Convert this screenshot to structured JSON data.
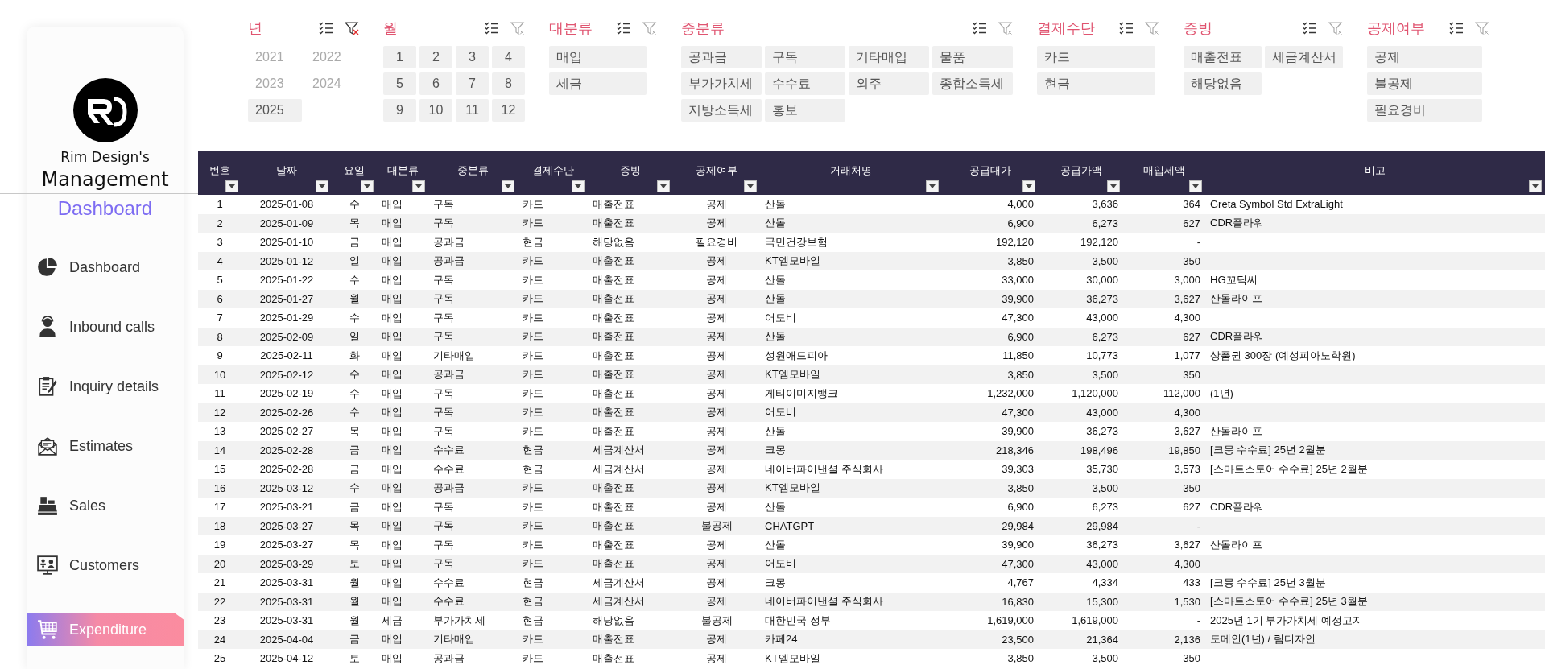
{
  "sidebar": {
    "brand_line1": "Rim Design's",
    "brand_line2": "Management",
    "brand_line3": "Dashboard",
    "items": [
      {
        "label": "Dashboard",
        "kind": "pie",
        "selected": false
      },
      {
        "label": "Inbound calls",
        "kind": "agent",
        "selected": false
      },
      {
        "label": "Inquiry details",
        "kind": "clipboard",
        "selected": false
      },
      {
        "label": "Estimates",
        "kind": "mail",
        "selected": false
      },
      {
        "label": "Sales",
        "kind": "register",
        "selected": false
      },
      {
        "label": "Customers",
        "kind": "contacts",
        "selected": false
      },
      {
        "label": "Expenditure",
        "kind": "cart",
        "selected": true
      }
    ]
  },
  "slicers": [
    {
      "title": "년",
      "filter_active": true,
      "items": [
        {
          "label": "2021",
          "selected": false
        },
        {
          "label": "2022",
          "selected": false
        },
        {
          "label": "2023",
          "selected": false
        },
        {
          "label": "2024",
          "selected": false
        },
        {
          "label": "2025",
          "selected": true
        }
      ]
    },
    {
      "title": "월",
      "filter_active": false,
      "items": [
        {
          "label": "1",
          "selected": true
        },
        {
          "label": "2",
          "selected": true
        },
        {
          "label": "3",
          "selected": true
        },
        {
          "label": "4",
          "selected": true
        },
        {
          "label": "5",
          "selected": true
        },
        {
          "label": "6",
          "selected": true
        },
        {
          "label": "7",
          "selected": true
        },
        {
          "label": "8",
          "selected": true
        },
        {
          "label": "9",
          "selected": true
        },
        {
          "label": "10",
          "selected": true
        },
        {
          "label": "11",
          "selected": true
        },
        {
          "label": "12",
          "selected": true
        }
      ]
    },
    {
      "title": "대분류",
      "filter_active": false,
      "items": [
        {
          "label": "매입",
          "selected": true
        },
        {
          "label": "세금",
          "selected": true
        }
      ]
    },
    {
      "title": "중분류",
      "filter_active": false,
      "items": [
        {
          "label": "공과금",
          "selected": true
        },
        {
          "label": "구독",
          "selected": true
        },
        {
          "label": "기타매입",
          "selected": true
        },
        {
          "label": "물품",
          "selected": true
        },
        {
          "label": "부가가치세",
          "selected": true
        },
        {
          "label": "수수료",
          "selected": true
        },
        {
          "label": "외주",
          "selected": true
        },
        {
          "label": "종합소득세",
          "selected": true
        },
        {
          "label": "지방소득세",
          "selected": true
        },
        {
          "label": "홍보",
          "selected": true
        }
      ]
    },
    {
      "title": "결제수단",
      "filter_active": false,
      "items": [
        {
          "label": "카드",
          "selected": true
        },
        {
          "label": "현금",
          "selected": true
        }
      ]
    },
    {
      "title": "증빙",
      "filter_active": false,
      "items": [
        {
          "label": "매출전표",
          "selected": true
        },
        {
          "label": "세금계산서",
          "selected": true
        },
        {
          "label": "해당없음",
          "selected": true
        }
      ]
    },
    {
      "title": "공제여부",
      "filter_active": false,
      "items": [
        {
          "label": "공제",
          "selected": true
        },
        {
          "label": "불공제",
          "selected": true
        },
        {
          "label": "필요경비",
          "selected": true
        }
      ]
    }
  ],
  "table": {
    "columns": [
      {
        "label": "번호"
      },
      {
        "label": "날짜"
      },
      {
        "label": "요일"
      },
      {
        "label": "대분류"
      },
      {
        "label": "중분류"
      },
      {
        "label": "결제수단"
      },
      {
        "label": "증빙"
      },
      {
        "label": "공제여부"
      },
      {
        "label": "거래처명"
      },
      {
        "label": "공급대가"
      },
      {
        "label": "공급가액"
      },
      {
        "label": "매입세액"
      },
      {
        "label": "비고"
      }
    ],
    "rows": [
      [
        "1",
        "2025-01-08",
        "수",
        "매입",
        "구독",
        "카드",
        "매출전표",
        "공제",
        "산돌",
        "4,000",
        "3,636",
        "364",
        "Greta Symbol Std ExtraLight"
      ],
      [
        "2",
        "2025-01-09",
        "목",
        "매입",
        "구독",
        "카드",
        "매출전표",
        "공제",
        "산돌",
        "6,900",
        "6,273",
        "627",
        "CDR플라워"
      ],
      [
        "3",
        "2025-01-10",
        "금",
        "매입",
        "공과금",
        "현금",
        "해당없음",
        "필요경비",
        "국민건강보험",
        "192,120",
        "192,120",
        "-"
      ],
      [
        "4",
        "2025-01-12",
        "일",
        "매입",
        "공과금",
        "카드",
        "매출전표",
        "공제",
        "KT엠모바일",
        "3,850",
        "3,500",
        "350"
      ],
      [
        "5",
        "2025-01-22",
        "수",
        "매입",
        "구독",
        "카드",
        "매출전표",
        "공제",
        "산돌",
        "33,000",
        "30,000",
        "3,000",
        "HG꼬딕씨"
      ],
      [
        "6",
        "2025-01-27",
        "월",
        "매입",
        "구독",
        "카드",
        "매출전표",
        "공제",
        "산돌",
        "39,900",
        "36,273",
        "3,627",
        "산돌라이프"
      ],
      [
        "7",
        "2025-01-29",
        "수",
        "매입",
        "구독",
        "카드",
        "매출전표",
        "공제",
        "어도비",
        "47,300",
        "43,000",
        "4,300"
      ],
      [
        "8",
        "2025-02-09",
        "일",
        "매입",
        "구독",
        "카드",
        "매출전표",
        "공제",
        "산돌",
        "6,900",
        "6,273",
        "627",
        "CDR플라워"
      ],
      [
        "9",
        "2025-02-11",
        "화",
        "매입",
        "기타매입",
        "카드",
        "매출전표",
        "공제",
        "성원애드피아",
        "11,850",
        "10,773",
        "1,077",
        "상품권 300장 (예성피아노학원)"
      ],
      [
        "10",
        "2025-02-12",
        "수",
        "매입",
        "공과금",
        "카드",
        "매출전표",
        "공제",
        "KT엠모바일",
        "3,850",
        "3,500",
        "350"
      ],
      [
        "11",
        "2025-02-19",
        "수",
        "매입",
        "구독",
        "카드",
        "매출전표",
        "공제",
        "게티이미지뱅크",
        "1,232,000",
        "1,120,000",
        "112,000",
        "(1년)"
      ],
      [
        "12",
        "2025-02-26",
        "수",
        "매입",
        "구독",
        "카드",
        "매출전표",
        "공제",
        "어도비",
        "47,300",
        "43,000",
        "4,300"
      ],
      [
        "13",
        "2025-02-27",
        "목",
        "매입",
        "구독",
        "카드",
        "매출전표",
        "공제",
        "산돌",
        "39,900",
        "36,273",
        "3,627",
        "산돌라이프"
      ],
      [
        "14",
        "2025-02-28",
        "금",
        "매입",
        "수수료",
        "현금",
        "세금계산서",
        "공제",
        "크몽",
        "218,346",
        "198,496",
        "19,850",
        "[크몽 수수료] 25년 2월분"
      ],
      [
        "15",
        "2025-02-28",
        "금",
        "매입",
        "수수료",
        "현금",
        "세금계산서",
        "공제",
        "네이버파이낸셜 주식회사",
        "39,303",
        "35,730",
        "3,573",
        "[스마트스토어 수수료] 25년 2월분"
      ],
      [
        "16",
        "2025-03-12",
        "수",
        "매입",
        "공과금",
        "카드",
        "매출전표",
        "공제",
        "KT엠모바일",
        "3,850",
        "3,500",
        "350"
      ],
      [
        "17",
        "2025-03-21",
        "금",
        "매입",
        "구독",
        "카드",
        "매출전표",
        "공제",
        "산돌",
        "6,900",
        "6,273",
        "627",
        "CDR플라워"
      ],
      [
        "18",
        "2025-03-27",
        "목",
        "매입",
        "구독",
        "카드",
        "매출전표",
        "불공제",
        "CHATGPT",
        "29,984",
        "29,984",
        "-"
      ],
      [
        "19",
        "2025-03-27",
        "목",
        "매입",
        "구독",
        "카드",
        "매출전표",
        "공제",
        "산돌",
        "39,900",
        "36,273",
        "3,627",
        "산돌라이프"
      ],
      [
        "20",
        "2025-03-29",
        "토",
        "매입",
        "구독",
        "카드",
        "매출전표",
        "공제",
        "어도비",
        "47,300",
        "43,000",
        "4,300"
      ],
      [
        "21",
        "2025-03-31",
        "월",
        "매입",
        "수수료",
        "현금",
        "세금계산서",
        "공제",
        "크몽",
        "4,767",
        "4,334",
        "433",
        "[크몽 수수료] 25년 3월분"
      ],
      [
        "22",
        "2025-03-31",
        "월",
        "매입",
        "수수료",
        "현금",
        "세금계산서",
        "공제",
        "네이버파이낸셜 주식회사",
        "16,830",
        "15,300",
        "1,530",
        "[스마트스토어 수수료] 25년 3월분"
      ],
      [
        "23",
        "2025-03-31",
        "월",
        "세금",
        "부가가치세",
        "현금",
        "해당없음",
        "불공제",
        "대한민국 정부",
        "1,619,000",
        "1,619,000",
        "-",
        "2025년 1기 부가가치세 예정고지"
      ],
      [
        "24",
        "2025-04-04",
        "금",
        "매입",
        "기타매입",
        "카드",
        "매출전표",
        "공제",
        "카페24",
        "23,500",
        "21,364",
        "2,136",
        "도메인(1년) / 림디자인"
      ],
      [
        "25",
        "2025-04-12",
        "토",
        "매입",
        "공과금",
        "카드",
        "매출전표",
        "공제",
        "KT엠모바일",
        "3,850",
        "3,500",
        "350"
      ]
    ]
  }
}
